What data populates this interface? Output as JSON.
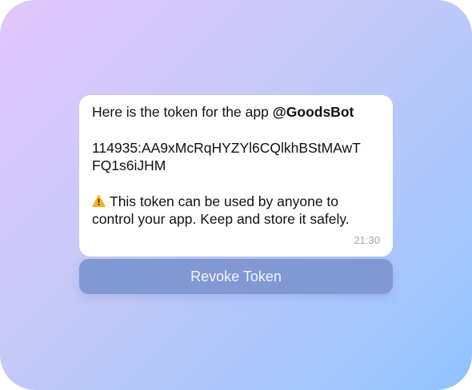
{
  "message": {
    "intro_text": "Here is the token for the app ",
    "bot_username": "@GoodsBot",
    "token_line_1": "114935:AA9xMcRqHYZYl6CQlkhBStMAwT",
    "token_line_2": "FQ1s6iJHM",
    "warning_icon": "warning-icon",
    "warning_line_1": "This token can be used by anyone to",
    "warning_line_2": "control your app. Keep and store it safely.",
    "time": "21:30"
  },
  "actions": {
    "revoke_label": "Revoke Token"
  },
  "colors": {
    "bubble_background": "#ffffff",
    "button_background": "#8198d2",
    "button_text": "#f2f5ff",
    "timestamp": "#a0a4aa",
    "warning": "#f6b31a"
  }
}
